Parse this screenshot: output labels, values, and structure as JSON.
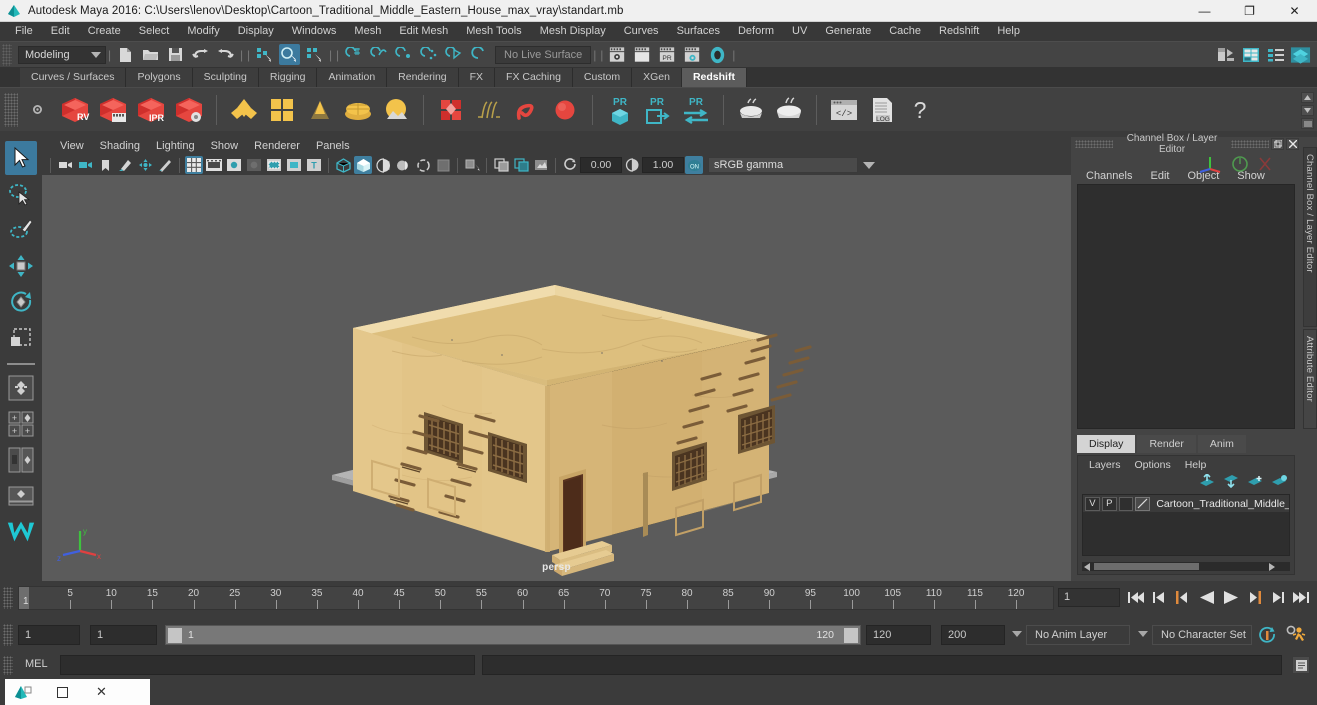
{
  "window": {
    "title": "Autodesk Maya 2016: C:\\Users\\lenov\\Desktop\\Cartoon_Traditional_Middle_Eastern_House_max_vray\\standart.mb",
    "minimize": "—",
    "restore": "❐",
    "close": "✕",
    "app_icon": "maya-icon"
  },
  "menubar": {
    "items": [
      "File",
      "Edit",
      "Create",
      "Select",
      "Modify",
      "Display",
      "Windows",
      "Mesh",
      "Edit Mesh",
      "Mesh Tools",
      "Mesh Display",
      "Curves",
      "Surfaces",
      "Deform",
      "UV",
      "Generate",
      "Cache",
      "Redshift",
      "Help"
    ]
  },
  "statusline": {
    "mode": "Modeling",
    "live_surface": "No Live Surface",
    "icons": [
      "new-scene-icon",
      "open-scene-icon",
      "save-scene-icon",
      "undo-icon",
      "redo-icon",
      "select-by-hierarchy-icon",
      "select-by-object-icon",
      "select-by-component-icon",
      "snap-to-grid-icon",
      "snap-to-curve-icon",
      "snap-to-point-icon",
      "snap-to-projected-center-icon",
      "snap-to-view-plane-icon",
      "make-live-icon",
      "render-current-frame-icon",
      "ipr-render-icon",
      "render-settings-icon",
      "hypershade-icon",
      "render-view-icon",
      "show-editors-icon",
      "channel-box-icon",
      "attribute-editor-icon",
      "tool-settings-icon"
    ]
  },
  "shelf": {
    "tabs": [
      "Curves / Surfaces",
      "Polygons",
      "Sculpting",
      "Rigging",
      "Animation",
      "Rendering",
      "FX",
      "FX Caching",
      "Custom",
      "XGen",
      "Redshift"
    ],
    "active_tab": "Redshift",
    "buttons": [
      {
        "name": "redshift-settings-icon",
        "label": ""
      },
      {
        "name": "redshift-render-view-icon",
        "label": "RV"
      },
      {
        "name": "redshift-render-sequence-icon",
        "label": ""
      },
      {
        "name": "redshift-ipr-icon",
        "label": "IPR"
      },
      {
        "name": "redshift-render-options-icon",
        "label": ""
      },
      {
        "name": "redshift-material-icon",
        "label": ""
      },
      {
        "name": "redshift-material-grid-icon",
        "label": ""
      },
      {
        "name": "redshift-light-cone-icon",
        "label": ""
      },
      {
        "name": "redshift-dome-light-icon",
        "label": ""
      },
      {
        "name": "redshift-sun-sky-icon",
        "label": ""
      },
      {
        "name": "redshift-proxy-icon",
        "label": ""
      },
      {
        "name": "redshift-hair-icon",
        "label": ""
      },
      {
        "name": "redshift-curve-icon",
        "label": ""
      },
      {
        "name": "redshift-sphere-icon",
        "label": ""
      },
      {
        "name": "redshift-pr-object-icon",
        "label": "PR"
      },
      {
        "name": "redshift-pr-export-icon",
        "label": "PR"
      },
      {
        "name": "redshift-pr-transfer-icon",
        "label": "PR"
      },
      {
        "name": "redshift-bake-icon",
        "label": ""
      },
      {
        "name": "redshift-bake-all-icon",
        "label": ""
      },
      {
        "name": "redshift-script-icon",
        "label": ""
      },
      {
        "name": "redshift-log-icon",
        "label": "LOG"
      },
      {
        "name": "redshift-help-icon",
        "label": "?"
      }
    ]
  },
  "toolbox": {
    "tools": [
      {
        "name": "select-tool",
        "selected": true
      },
      {
        "name": "lasso-select-tool",
        "selected": false
      },
      {
        "name": "paint-select-tool",
        "selected": false
      },
      {
        "name": "move-tool",
        "selected": false
      },
      {
        "name": "rotate-tool",
        "selected": false
      },
      {
        "name": "scale-tool",
        "selected": false
      },
      {
        "name": "last-tool-used",
        "selected": false
      },
      {
        "name": "four-view-layout",
        "selected": false
      },
      {
        "name": "persp-outliner-layout",
        "selected": false
      },
      {
        "name": "single-perspective-layout",
        "selected": false
      },
      {
        "name": "maya-logo-icon",
        "selected": false
      }
    ]
  },
  "viewport": {
    "menus": [
      "View",
      "Shading",
      "Lighting",
      "Show",
      "Renderer",
      "Panels"
    ],
    "camera_label": "persp",
    "exposure": "0.00",
    "gamma": "1.00",
    "color_space": "sRGB gamma",
    "toolbar_icons": [
      "select-camera-icon",
      "lock-camera-icon",
      "bookmark-icon",
      "image-plane-icon",
      "two-d-pan-zoom-icon",
      "grease-pencil-icon",
      "grid-icon",
      "film-gate-icon",
      "resolution-gate-icon",
      "gate-mask-icon",
      "film-origin-icon",
      "safe-action-icon",
      "safe-title-icon",
      "wireframe-icon",
      "smooth-shade-all-icon",
      "shade-selected-icon",
      "wireframe-on-shaded-icon",
      "textured-icon",
      "lighting-icon",
      "shadows-icon",
      "ao-icon",
      "motion-blur-icon",
      "multisample-icon",
      "xray-icon",
      "xray-joints-icon",
      "isolate-select-icon",
      "display-layer-icon",
      "snapshot-icon",
      "exposure-icon",
      "gamma-icon",
      "view-transform-toggle-icon"
    ],
    "scene_object": "Cartoon Traditional Middle Eastern House"
  },
  "channel_box": {
    "panel_title": "Channel Box / Layer Editor",
    "menus": [
      "Channels",
      "Edit",
      "Object",
      "Show"
    ],
    "side_tabs": [
      "Channel Box / Layer Editor",
      "Attribute Editor"
    ],
    "undock_icon": "undock-icon",
    "close_icon": "close-icon"
  },
  "layer_editor": {
    "tabs": [
      "Display",
      "Render",
      "Anim"
    ],
    "active_tab": "Display",
    "menus": [
      "Layers",
      "Options",
      "Help"
    ],
    "toolbar_icons": [
      "move-layer-up-icon",
      "move-layer-down-icon",
      "new-layer-icon",
      "new-layer-from-selected-icon"
    ],
    "layers": [
      {
        "visibility": "V",
        "playback": "P",
        "shading": "",
        "name": "Cartoon_Traditional_Middle_"
      }
    ]
  },
  "timeslider": {
    "ticks": [
      5,
      10,
      15,
      20,
      25,
      30,
      35,
      40,
      45,
      50,
      55,
      60,
      65,
      70,
      75,
      80,
      85,
      90,
      95,
      100,
      105,
      110,
      115,
      120
    ],
    "current_frame_marker": "1",
    "current_frame": "1",
    "playback_buttons": [
      "go-to-start-icon",
      "step-back-keyframe-icon",
      "step-back-frame-icon",
      "play-backwards-icon",
      "play-forwards-icon",
      "step-forward-frame-icon",
      "step-forward-keyframe-icon",
      "go-to-end-icon"
    ]
  },
  "rangeslider": {
    "anim_start": "1",
    "range_start": "1",
    "bar_start": "1",
    "bar_end": "120",
    "range_end": "120",
    "anim_end": "200",
    "anim_layer": "No Anim Layer",
    "character_set": "No Character Set",
    "auto_key_icon": "auto-keyframe-icon",
    "anim_prefs_icon": "animation-preferences-icon"
  },
  "command_line": {
    "language": "MEL",
    "input_value": "",
    "output_value": "",
    "script_editor_icon": "script-editor-icon"
  },
  "taskbar": {
    "app_icon": "maya-taskbar-icon",
    "restore_icon": "restore-icon",
    "close_icon": "close-icon"
  },
  "colors": {
    "accent": "#3c7a9e",
    "window_bg": "#3b3b3b",
    "viewport_bg": "#5a5a5a",
    "house_wall": "#e0c183",
    "house_wall_dark": "#c9a96a",
    "house_roof": "#e7cb91",
    "ground": "#b0b0b0",
    "door": "#5a3420",
    "redshift_red": "#e23b36"
  }
}
